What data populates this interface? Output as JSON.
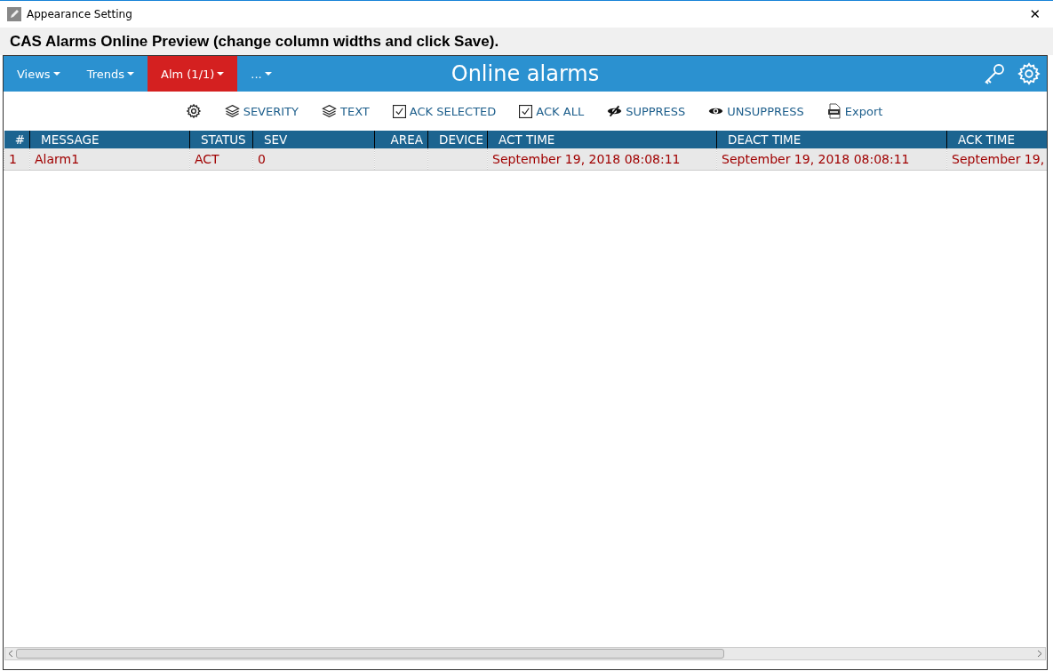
{
  "window": {
    "title": "Appearance Setting",
    "close": "✕"
  },
  "heading": "CAS Alarms Online Preview (change column widths and click Save).",
  "nav": {
    "tabs": [
      {
        "label": "Views",
        "selected": false
      },
      {
        "label": "Trends",
        "selected": false
      },
      {
        "label": "Alm (1/1)",
        "selected": true
      },
      {
        "label": "...",
        "selected": false
      }
    ],
    "title": "Online alarms"
  },
  "toolbar": [
    {
      "kind": "gear"
    },
    {
      "kind": "layers",
      "label": "SEVERITY"
    },
    {
      "kind": "layers",
      "label": "TEXT"
    },
    {
      "kind": "check",
      "label": "ACK SELECTED"
    },
    {
      "kind": "check",
      "label": "ACK ALL"
    },
    {
      "kind": "eye-off",
      "label": "SUPPRESS"
    },
    {
      "kind": "eye",
      "label": "UNSUPPRESS"
    },
    {
      "kind": "xls",
      "label": "Export"
    }
  ],
  "table": {
    "columns": [
      "#",
      "MESSAGE",
      "STATUS",
      "SEV",
      "AREA",
      "DEVICE",
      "ACT TIME",
      "DEACT TIME",
      "ACK TIME"
    ],
    "rows": [
      [
        "1",
        "Alarm1",
        "ACT",
        "0",
        "",
        "",
        "September 19, 2018 08:08:11",
        "September 19, 2018 08:08:11",
        "September 19,"
      ]
    ]
  }
}
